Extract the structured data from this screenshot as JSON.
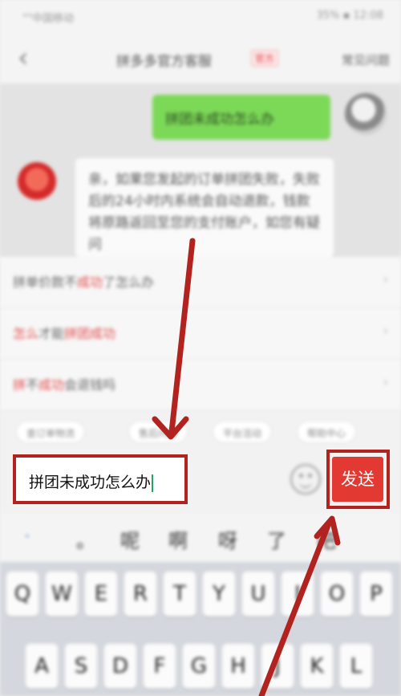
{
  "status_bar": {
    "left": "\"\"中国移动",
    "right": "35% ▪ 12:08"
  },
  "nav": {
    "back_icon": "chevron-left-icon",
    "title": "拼多多官方客服",
    "tag": "官方",
    "faq": "常见问题"
  },
  "messages": [
    {
      "from": "user",
      "text": "拼团未成功怎么办"
    },
    {
      "from": "bot",
      "text": "亲，如果您发起的订单拼团失败，失败后的24小时内系统会自动退款，钱款将原路返回至您的支付账户，如您有疑问"
    }
  ],
  "suggestions": [
    {
      "parts": [
        {
          "t": "拼单价款不",
          "red": false
        },
        {
          "t": "成功",
          "red": true
        },
        {
          "t": "了怎么办",
          "red": false
        }
      ]
    },
    {
      "parts": [
        {
          "t": "怎么",
          "red": true
        },
        {
          "t": "才能",
          "red": false
        },
        {
          "t": "拼团成功",
          "red": true
        }
      ]
    },
    {
      "parts": [
        {
          "t": "拼",
          "red": true
        },
        {
          "t": "不",
          "red": false
        },
        {
          "t": "成功",
          "red": true
        },
        {
          "t": "会退钱吗",
          "red": false
        }
      ]
    }
  ],
  "quick_chips": [
    "查订单物流",
    "售后问题",
    "平台活动",
    "帮助中心"
  ],
  "input": {
    "value": "拼团未成功怎么办"
  },
  "send_label": "发送",
  "candidates": [
    "·",
    "。",
    "呢",
    "啊",
    "呀",
    "了",
    "吧"
  ],
  "keyboard": {
    "row1": [
      "Q",
      "W",
      "E",
      "R",
      "T",
      "Y",
      "U",
      "I",
      "O",
      "P"
    ],
    "row2": [
      "A",
      "S",
      "D",
      "F",
      "G",
      "H",
      "J",
      "K",
      "L"
    ]
  },
  "colors": {
    "accent": "#e23a33",
    "annotation": "#b2231f",
    "user_bubble": "#7cd957"
  }
}
